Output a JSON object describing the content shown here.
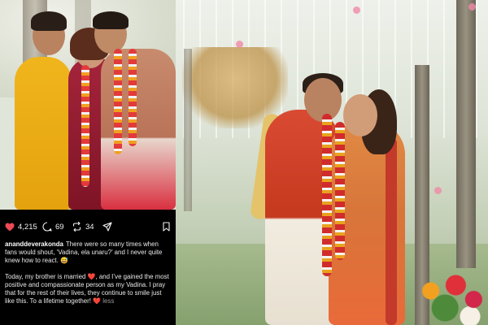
{
  "post": {
    "likes": "4,215",
    "comments": "69",
    "reposts": "34",
    "username": "ananddeverakonda",
    "caption_line1": "There were so many times when fans would shout, ‘Vadina, ela unaru?’ and I never quite knew how to react.",
    "emoji_smile": "😅",
    "caption_p2_a": "Today, my brother is married",
    "heart": "❤️",
    "caption_p2_b": ", and I’ve gained the most positive and compassionate person as my Vadina. I pray that for the rest of their lives, they continue to smile just like this. To a lifetime together!",
    "less_label": "less"
  },
  "icons": {
    "like": "heart-icon",
    "comment": "comment-icon",
    "repost": "repost-icon",
    "share": "share-icon",
    "save": "bookmark-icon"
  },
  "colors": {
    "card_bg": "#000000",
    "heart": "#ed4956",
    "text": "#e8e8e8",
    "muted": "#9a9a9a"
  }
}
